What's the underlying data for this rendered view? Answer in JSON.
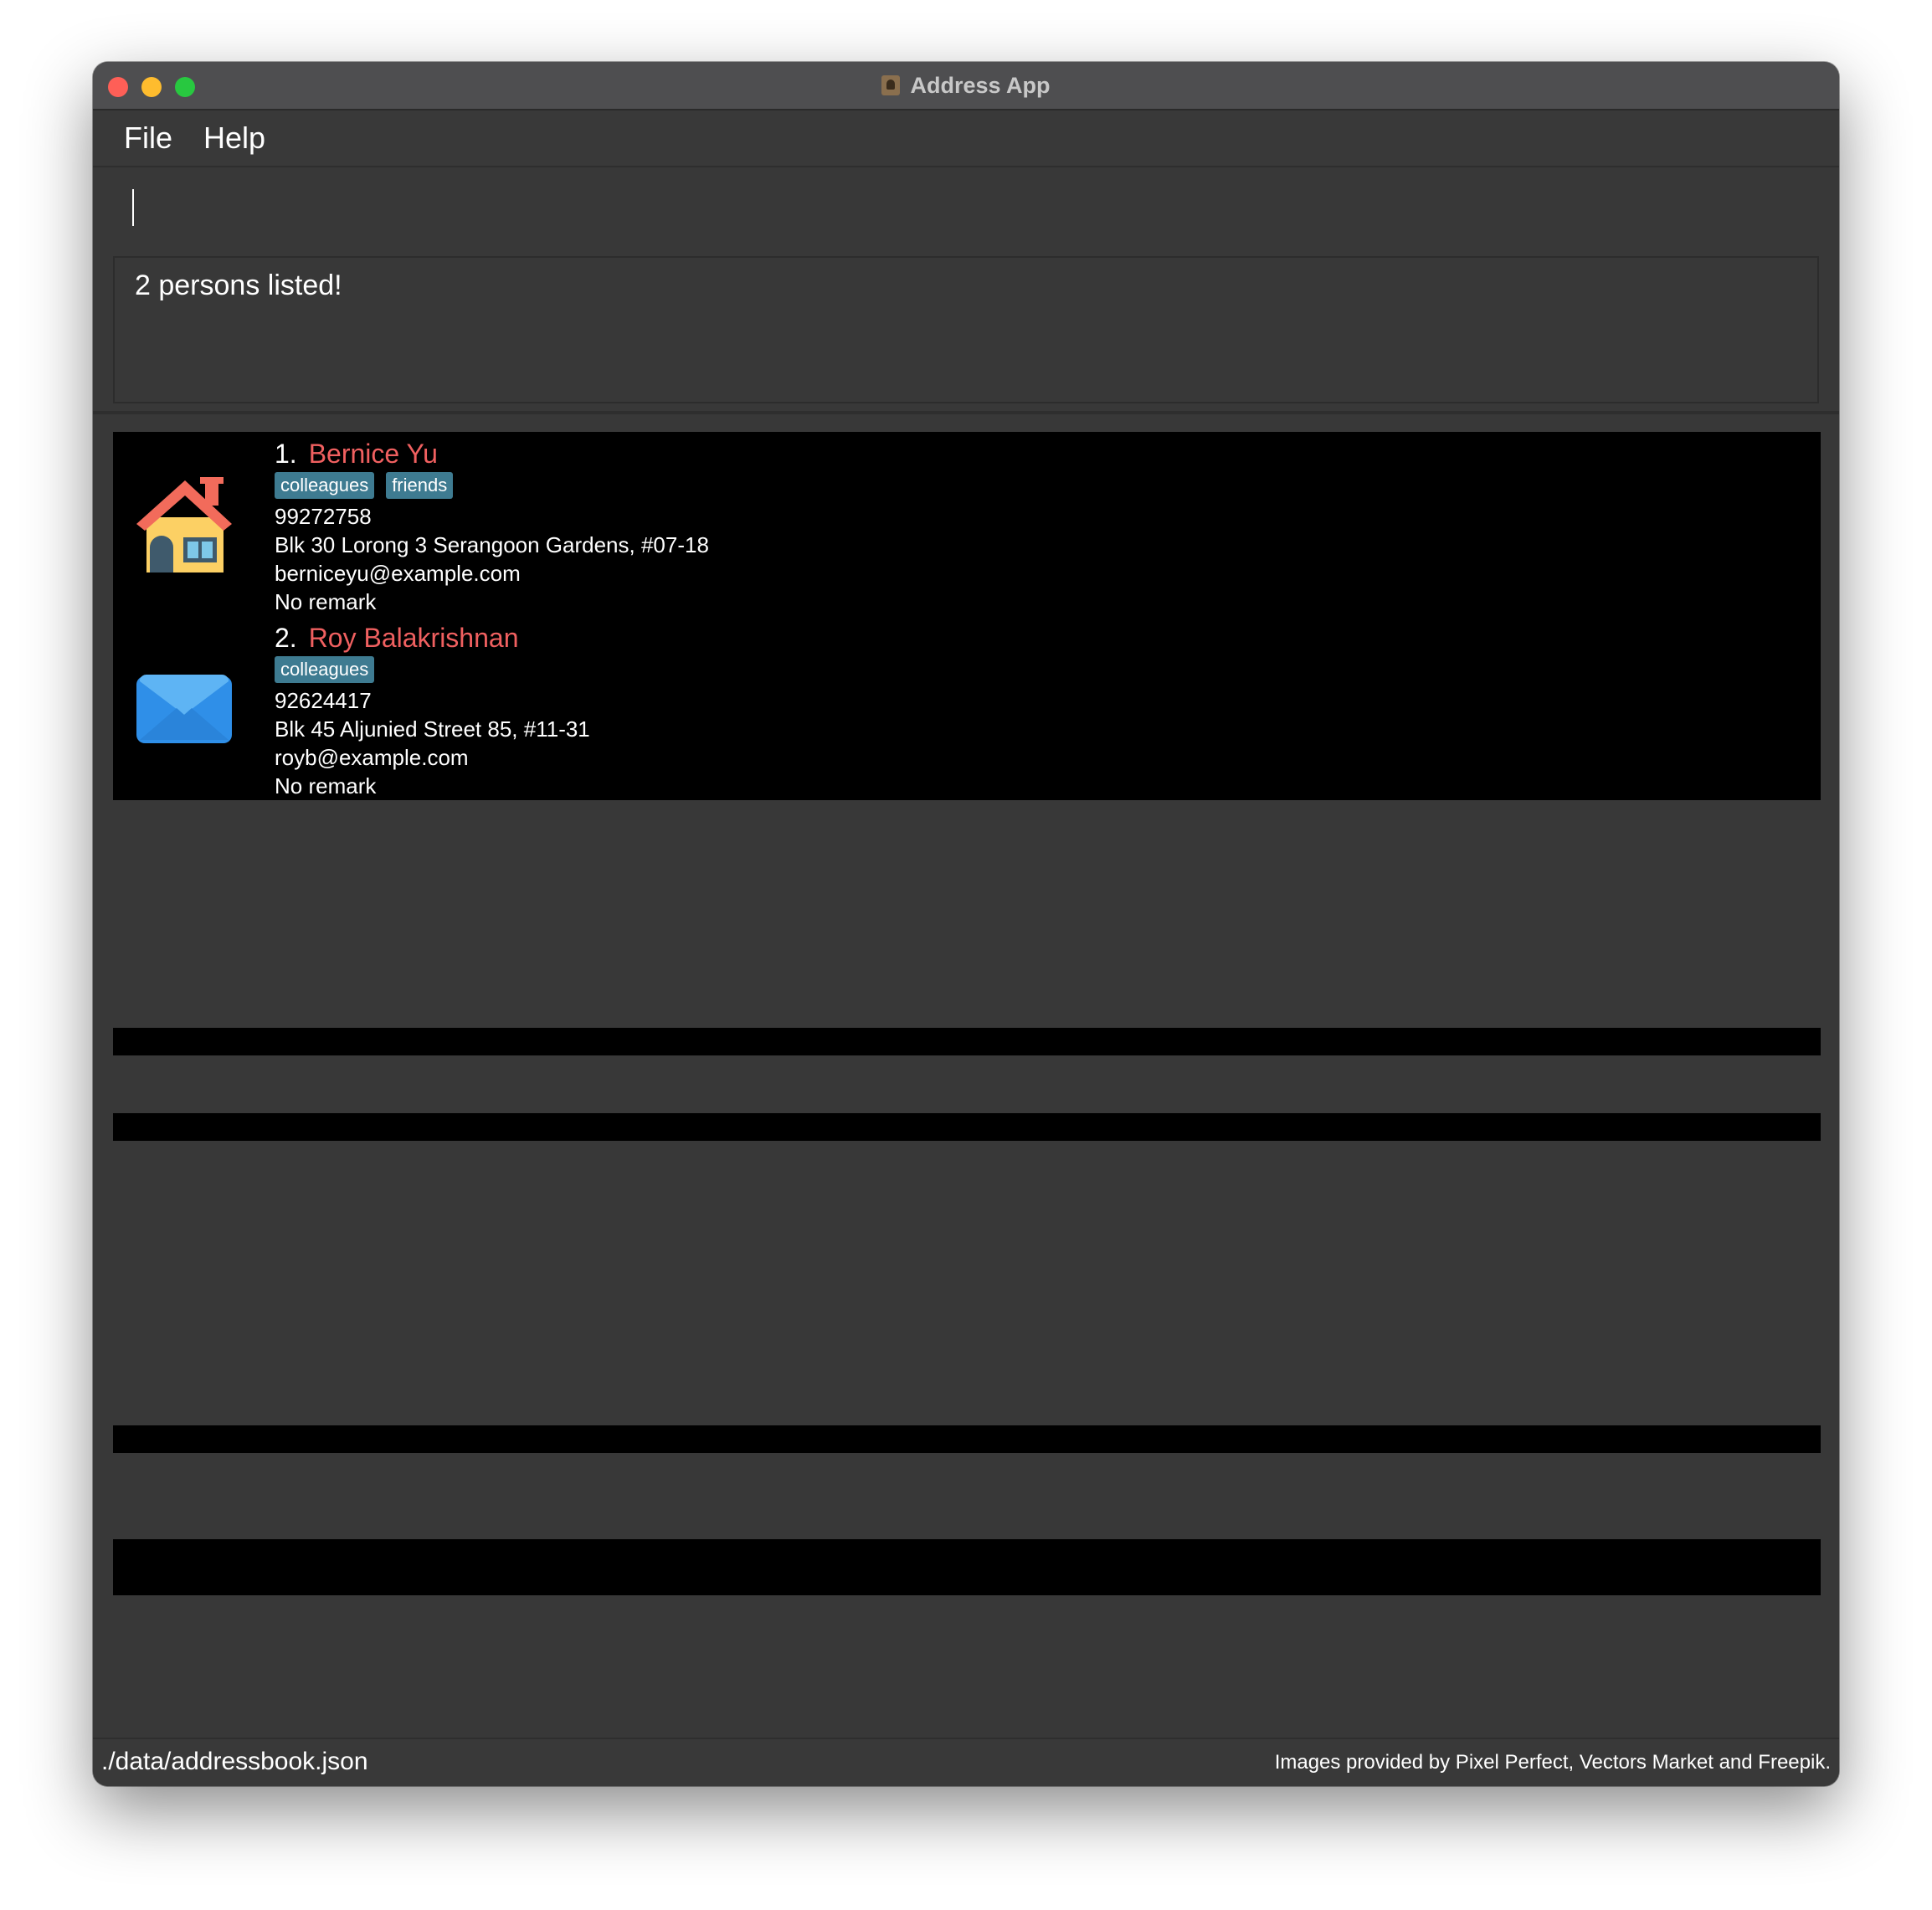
{
  "window": {
    "title": "Address App"
  },
  "menu": {
    "file": "File",
    "help": "Help"
  },
  "command": {
    "value": "",
    "placeholder": ""
  },
  "result": {
    "text": "2 persons listed!"
  },
  "persons": [
    {
      "index": "1.",
      "name": "Bernice Yu",
      "tags": [
        "colleagues",
        "friends"
      ],
      "phone": "99272758",
      "address": "Blk 30 Lorong 3 Serangoon Gardens, #07-18",
      "email": "berniceyu@example.com",
      "remark": "No remark",
      "icon": "house-icon"
    },
    {
      "index": "2.",
      "name": "Roy Balakrishnan",
      "tags": [
        "colleagues"
      ],
      "phone": "92624417",
      "address": "Blk 45 Aljunied Street 85, #11-31",
      "email": "royb@example.com",
      "remark": "No remark",
      "icon": "envelope-icon"
    }
  ],
  "status": {
    "file_path": "./data/addressbook.json",
    "credits": "Images provided by Pixel Perfect, Vectors Market and Freepik."
  },
  "colors": {
    "background": "#383838",
    "name": "#f06060",
    "tag": "#3e7b91",
    "list": "#000000"
  }
}
